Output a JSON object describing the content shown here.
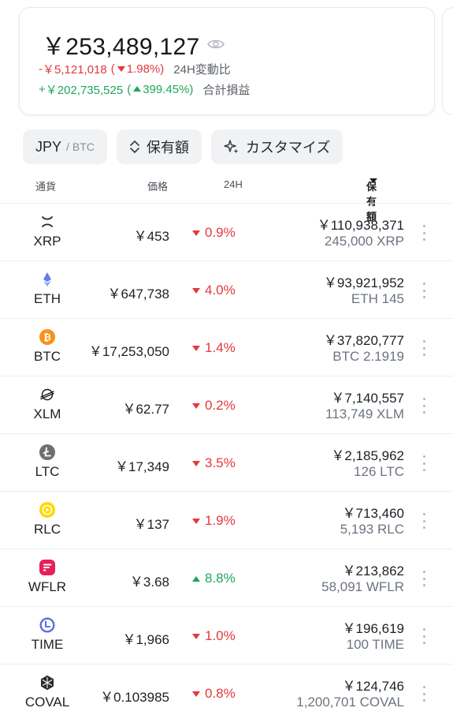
{
  "summary": {
    "total": "￥253,489,127",
    "change_24h": {
      "sign": "-",
      "amount": "￥5,121,018",
      "paren_open": "(",
      "percent": "1.98%)",
      "label": "24H変動比"
    },
    "total_pl": {
      "sign": "+",
      "amount": "￥202,735,525",
      "paren_open": "(",
      "percent": "399.45%)",
      "label": "合計損益"
    }
  },
  "toolbar": {
    "currency_primary": "JPY",
    "currency_sep": "/",
    "currency_secondary": "BTC",
    "sort_label": "保有額",
    "customize_label": "カスタマイズ"
  },
  "table": {
    "headers": {
      "currency": "通貨",
      "price": "価格",
      "change": "24H",
      "holding": "保有額"
    },
    "rows": [
      {
        "symbol": "XRP",
        "icon": "xrp-icon",
        "price": "￥453",
        "change": "0.9%",
        "dir": "down",
        "value": "￥110,938,371",
        "amount": "245,000 XRP",
        "color": "#23292f"
      },
      {
        "symbol": "ETH",
        "icon": "eth-icon",
        "price": "￥647,738",
        "change": "4.0%",
        "dir": "down",
        "value": "￥93,921,952",
        "amount": "ETH 145",
        "color": "#627eea"
      },
      {
        "symbol": "BTC",
        "icon": "btc-icon",
        "price": "￥17,253,050",
        "change": "1.4%",
        "dir": "down",
        "value": "￥37,820,777",
        "amount": "BTC 2.1919",
        "color": "#f7931a"
      },
      {
        "symbol": "XLM",
        "icon": "xlm-icon",
        "price": "￥62.77",
        "change": "0.2%",
        "dir": "down",
        "value": "￥7,140,557",
        "amount": "113,749 XLM",
        "color": "#14161a"
      },
      {
        "symbol": "LTC",
        "icon": "ltc-icon",
        "price": "￥17,349",
        "change": "3.5%",
        "dir": "down",
        "value": "￥2,185,962",
        "amount": "126 LTC",
        "color": "#6f6f6f"
      },
      {
        "symbol": "RLC",
        "icon": "rlc-icon",
        "price": "￥137",
        "change": "1.9%",
        "dir": "down",
        "value": "￥713,460",
        "amount": "5,193 RLC",
        "color": "#ffd800"
      },
      {
        "symbol": "WFLR",
        "icon": "wflr-icon",
        "price": "￥3.68",
        "change": "8.8%",
        "dir": "up",
        "value": "￥213,862",
        "amount": "58,091 WFLR",
        "color": "#e62058"
      },
      {
        "symbol": "TIME",
        "icon": "time-icon",
        "price": "￥1,966",
        "change": "1.0%",
        "dir": "down",
        "value": "￥196,619",
        "amount": "100 TIME",
        "color": "#5b6ee1"
      },
      {
        "symbol": "COVAL",
        "icon": "coval-icon",
        "price": "￥0.103985",
        "change": "0.8%",
        "dir": "down",
        "value": "￥124,746",
        "amount": "1,200,701 COVAL",
        "color": "#2b2b2b"
      }
    ]
  },
  "colors": {
    "up": "#1fa65b",
    "down": "#e5383b",
    "chip_bg": "#f1f2f4"
  }
}
